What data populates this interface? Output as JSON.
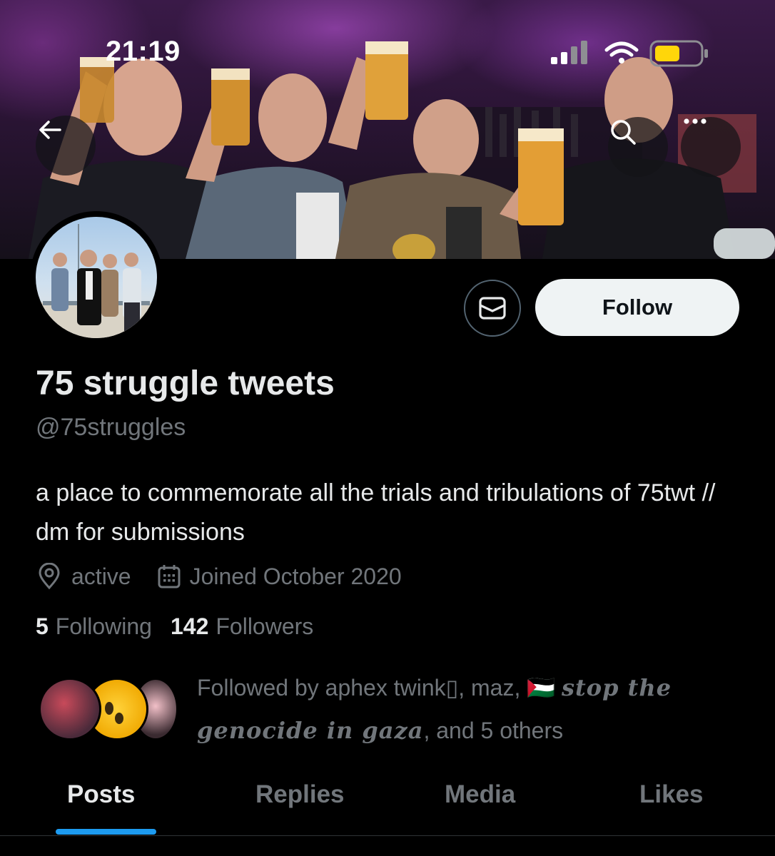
{
  "status_bar": {
    "time": "21:19"
  },
  "profile": {
    "display_name": "75 struggle tweets",
    "handle": "@75struggles",
    "bio": "a place to commemorate all the trials and tribulations of 75twt // dm for submissions",
    "location": "active",
    "joined": "Joined October 2020",
    "following_count": "5",
    "following_label": "Following",
    "followers_count": "142",
    "followers_label": "Followers"
  },
  "actions": {
    "follow_label": "Follow"
  },
  "followed_by": {
    "prefix": "Followed by aphex twink",
    "glyph": "▯",
    "middle": ", maz, ",
    "flag": "🇵🇸",
    "gothic_name": "stop the genocide in gaza",
    "suffix": ", and 5 others"
  },
  "tabs": [
    {
      "label": "Posts"
    },
    {
      "label": "Replies"
    },
    {
      "label": "Media"
    },
    {
      "label": "Likes"
    }
  ],
  "icons": {
    "back": "arrow-left-icon",
    "search": "search-icon",
    "more": "more-icon",
    "message": "envelope-icon",
    "location": "location-pin-icon",
    "calendar": "calendar-icon"
  },
  "colors": {
    "accent": "#1d9bf0",
    "battery": "#ffd60a",
    "muted": "#71767b"
  }
}
